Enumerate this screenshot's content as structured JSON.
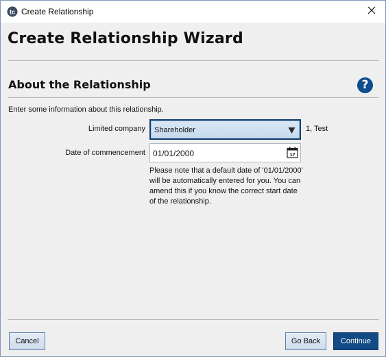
{
  "window": {
    "title": "Create Relationship",
    "app_icon": "tc-logo-icon",
    "close_icon": "close-icon"
  },
  "wizard": {
    "title": "Create Relationship Wizard"
  },
  "section": {
    "title": "About the Relationship",
    "help_glyph": "?",
    "intro": "Enter some information about this relationship."
  },
  "form": {
    "company_label": "Limited company",
    "company_selected": "Shareholder",
    "company_side_value": "1, Test",
    "date_label": "Date of commencement",
    "date_value": "01/01/2000",
    "calendar_icon": "calendar-icon",
    "calendar_day": "17",
    "note": "Please note that a default date of '01/01/2000' will be automatically entered for you. You can amend this if you know the correct start date of the relationship."
  },
  "buttons": {
    "cancel": "Cancel",
    "back": "Go Back",
    "continue": "Continue"
  },
  "colors": {
    "accent": "#114a84",
    "help_icon": "#0e4c8c",
    "select_border": "#123d6c"
  }
}
